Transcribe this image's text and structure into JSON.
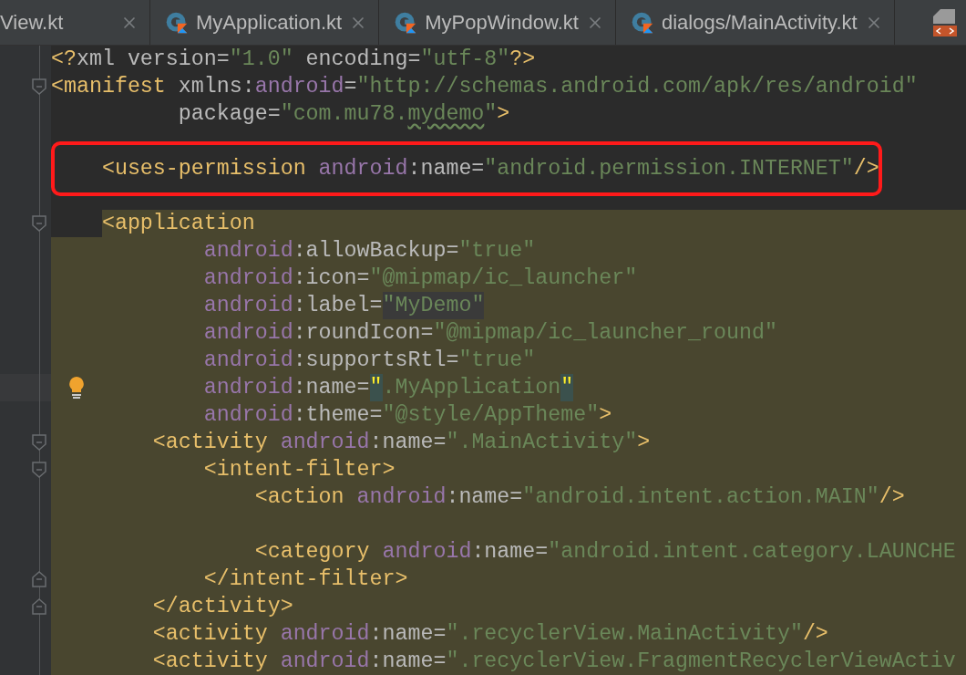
{
  "tabs": [
    {
      "label": "View.kt",
      "clipped": true
    },
    {
      "label": "MyApplication.kt",
      "clipped": false
    },
    {
      "label": "MyPopWindow.kt",
      "clipped": false
    },
    {
      "label": "dialogs/MainActivity.kt",
      "clipped": false
    }
  ],
  "lines": [
    {
      "tokens": [
        {
          "kind": "tag",
          "text": "<?"
        },
        {
          "kind": "attr",
          "text": "xml version="
        },
        {
          "kind": "value",
          "text": "\"1.0\""
        },
        {
          "kind": "attr",
          "text": " encoding="
        },
        {
          "kind": "value",
          "text": "\"utf-8\""
        },
        {
          "kind": "tag",
          "text": "?>"
        }
      ]
    },
    {
      "fold_start": true,
      "tokens": [
        {
          "kind": "tag",
          "text": "<manifest "
        },
        {
          "kind": "attr",
          "text": "xmlns:"
        },
        {
          "kind": "ns",
          "text": "android"
        },
        {
          "kind": "attr",
          "text": "="
        },
        {
          "kind": "value",
          "text": "\"http://schemas.android.com/apk/res/android\""
        }
      ]
    },
    {
      "tokens": [
        {
          "kind": "attr",
          "text": "          package="
        },
        {
          "kind": "value",
          "text": "\"com.mu78."
        },
        {
          "kind": "value",
          "text": "mydemo",
          "typo": true
        },
        {
          "kind": "value",
          "text": "\""
        },
        {
          "kind": "tag",
          "text": ">"
        }
      ]
    },
    {
      "blank_line_before": true,
      "boxed": true,
      "tokens": [
        {
          "kind": "tag",
          "text": "    <uses-permission "
        },
        {
          "kind": "ns",
          "text": "android"
        },
        {
          "kind": "attr",
          "text": ":name="
        },
        {
          "kind": "value",
          "text": "\"android.permission.INTERNET\""
        },
        {
          "kind": "tag",
          "text": "/>"
        }
      ]
    },
    {
      "blank_line_before": true,
      "fold_start": true,
      "highlighted": true,
      "selection_start": true,
      "tokens": [
        {
          "kind": "tag",
          "text": "    <application"
        }
      ]
    },
    {
      "highlighted": true,
      "tokens": [
        {
          "kind": "ns",
          "text": "            android"
        },
        {
          "kind": "attr",
          "text": ":allowBackup="
        },
        {
          "kind": "value",
          "text": "\"true\""
        }
      ]
    },
    {
      "highlighted": true,
      "tokens": [
        {
          "kind": "ns",
          "text": "            android"
        },
        {
          "kind": "attr",
          "text": ":icon="
        },
        {
          "kind": "value",
          "text": "\"@mipmap/ic_launcher\""
        }
      ]
    },
    {
      "highlighted": true,
      "tokens": [
        {
          "kind": "ns",
          "text": "            android"
        },
        {
          "kind": "attr",
          "text": ":label="
        },
        {
          "kind": "value",
          "text": "\"MyDemo\"",
          "folded": true
        }
      ]
    },
    {
      "highlighted": true,
      "tokens": [
        {
          "kind": "ns",
          "text": "            android"
        },
        {
          "kind": "attr",
          "text": ":roundIcon="
        },
        {
          "kind": "value",
          "text": "\"@mipmap/ic_launcher_round\""
        }
      ]
    },
    {
      "highlighted": true,
      "tokens": [
        {
          "kind": "ns",
          "text": "            android"
        },
        {
          "kind": "attr",
          "text": ":supportsRtl="
        },
        {
          "kind": "value",
          "text": "\"true\""
        }
      ]
    },
    {
      "highlighted": true,
      "current": true,
      "bulb": true,
      "tokens": [
        {
          "kind": "ns",
          "text": "            android"
        },
        {
          "kind": "attr",
          "text": ":name="
        },
        {
          "kind": "value",
          "text": "\"",
          "matched": true
        },
        {
          "kind": "value",
          "text": ".MyApplication"
        },
        {
          "kind": "value",
          "text": "\"",
          "matched": true
        }
      ]
    },
    {
      "highlighted": true,
      "tokens": [
        {
          "kind": "ns",
          "text": "            android"
        },
        {
          "kind": "attr",
          "text": ":theme="
        },
        {
          "kind": "value",
          "text": "\"@style/AppTheme\""
        },
        {
          "kind": "tag",
          "text": ">"
        }
      ]
    },
    {
      "highlighted": true,
      "fold_start": true,
      "tokens": [
        {
          "kind": "tag",
          "text": "        <activity "
        },
        {
          "kind": "ns",
          "text": "android"
        },
        {
          "kind": "attr",
          "text": ":name="
        },
        {
          "kind": "value",
          "text": "\".MainActivity\""
        },
        {
          "kind": "tag",
          "text": ">"
        }
      ]
    },
    {
      "highlighted": true,
      "fold_start": true,
      "tokens": [
        {
          "kind": "tag",
          "text": "            <intent-filter>"
        }
      ]
    },
    {
      "highlighted": true,
      "tokens": [
        {
          "kind": "tag",
          "text": "                <action "
        },
        {
          "kind": "ns",
          "text": "android"
        },
        {
          "kind": "attr",
          "text": ":name="
        },
        {
          "kind": "value",
          "text": "\"android.intent.action.MAIN\""
        },
        {
          "kind": "tag",
          "text": "/>"
        }
      ]
    },
    {
      "blank_line_before": true,
      "highlighted": true,
      "tokens": [
        {
          "kind": "tag",
          "text": "                <category "
        },
        {
          "kind": "ns",
          "text": "android"
        },
        {
          "kind": "attr",
          "text": ":name="
        },
        {
          "kind": "value",
          "text": "\"android.intent.category.LAUNCHE"
        }
      ]
    },
    {
      "highlighted": true,
      "fold_end": true,
      "tokens": [
        {
          "kind": "tag",
          "text": "            </intent-filter>"
        }
      ]
    },
    {
      "highlighted": true,
      "fold_end": true,
      "tokens": [
        {
          "kind": "tag",
          "text": "        </activity>"
        }
      ]
    },
    {
      "highlighted": true,
      "tokens": [
        {
          "kind": "tag",
          "text": "        <activity "
        },
        {
          "kind": "ns",
          "text": "android"
        },
        {
          "kind": "attr",
          "text": ":name="
        },
        {
          "kind": "value",
          "text": "\".recyclerView.MainActivity\""
        },
        {
          "kind": "tag",
          "text": "/>"
        }
      ]
    },
    {
      "highlighted": true,
      "tokens": [
        {
          "kind": "tag",
          "text": "        <activity "
        },
        {
          "kind": "ns",
          "text": "android"
        },
        {
          "kind": "attr",
          "text": ":name="
        },
        {
          "kind": "value",
          "text": "\".recyclerView.FragmentRecyclerViewActiv"
        }
      ]
    }
  ]
}
